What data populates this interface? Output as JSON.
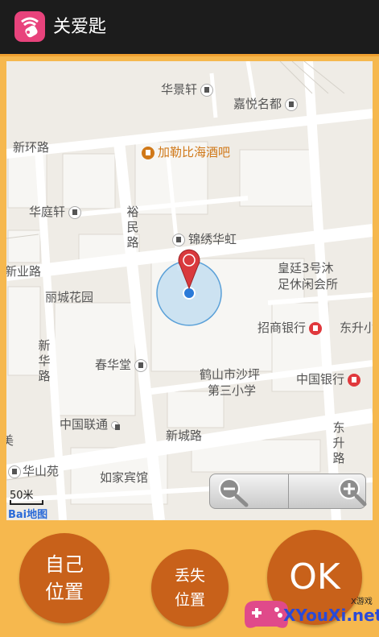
{
  "app": {
    "title": "关爱匙"
  },
  "map": {
    "labels": {
      "huajingxuan": "华景轩",
      "jiayuemingdu": "嘉悦名都",
      "xinhuanlu": "新环路",
      "jialebi": "加勒比海酒吧",
      "huatingxuan": "华庭轩",
      "yuminlu": "裕民路",
      "jinxiuhuahong": "锦绣华虹",
      "xinyelu": "新业路",
      "huangting": "皇廷3号沐",
      "huangting2": "足休闲会所",
      "lichenghuayuan": "丽城花园",
      "zhaoshang": "招商银行",
      "dongsheng_short": "东升小",
      "xinhualu": "新华路",
      "chunhuatang": "春华堂",
      "heshan1": "鹤山市沙坪",
      "heshan2": "第三小学",
      "zhongguoyinhang": "中国银行",
      "zhongguoliantong": "中国联通",
      "xinchenglu": "新城路",
      "dongshenglu": "东升路",
      "huashanyuan": "华山苑",
      "rujia": "如家宾馆",
      "partial_left": "美"
    },
    "scale": "50米",
    "logo": "Bai地图"
  },
  "zoom": {
    "out_icon": "zoom-out-icon",
    "in_icon": "zoom-in-icon"
  },
  "buttons": {
    "my_location_line1": "自己",
    "my_location_line2": "位置",
    "lost_location_line1": "丢失",
    "lost_location_line2": "位置",
    "ok": "OK"
  },
  "watermark": {
    "text": "XYouXi.net",
    "small": "X游戏"
  },
  "colors": {
    "accent": "#f6b84e",
    "button": "#c8611a",
    "pin": "#d9393d",
    "location_dot": "#2a7ad8"
  }
}
